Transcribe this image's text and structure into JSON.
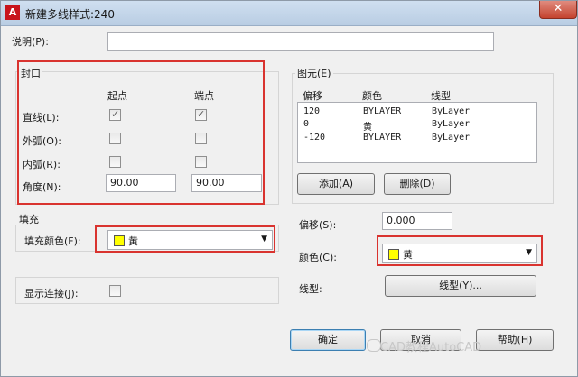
{
  "window": {
    "title": "新建多线样式:240",
    "ghost_text": ""
  },
  "description": {
    "label": "说明(P):",
    "value": ""
  },
  "caps": {
    "group_label": "封口",
    "col_start": "起点",
    "col_end": "端点",
    "line_label": "直线(L):",
    "outer_arc_label": "外弧(O):",
    "inner_arc_label": "内弧(R):",
    "angle_label": "角度(N):",
    "line_start_checked": true,
    "line_end_checked": true,
    "outer_start_checked": false,
    "outer_end_checked": false,
    "inner_start_checked": false,
    "inner_end_checked": false,
    "angle_start": "90.00",
    "angle_end": "90.00"
  },
  "fill": {
    "group_label": "填充",
    "color_label": "填充颜色(F):",
    "color_value": "黄",
    "color_hex": "#ffff00"
  },
  "joints": {
    "label": "显示连接(J):",
    "checked": false
  },
  "elements": {
    "group_label": "图元(E)",
    "headers": {
      "offset": "偏移",
      "color": "颜色",
      "linetype": "线型"
    },
    "rows": [
      {
        "offset": "120",
        "color": "BYLAYER",
        "linetype": "ByLayer"
      },
      {
        "offset": "0",
        "color": "黄",
        "linetype": "ByLayer"
      },
      {
        "offset": "-120",
        "color": "BYLAYER",
        "linetype": "ByLayer"
      }
    ],
    "add_label": "添加(A)",
    "delete_label": "删除(D)",
    "offset_label": "偏移(S):",
    "offset_value": "0.000",
    "color_label": "颜色(C):",
    "color_value": "黄",
    "linetype_label": "线型:",
    "linetype_button": "线型(Y)..."
  },
  "buttons": {
    "ok": "确定",
    "cancel": "取消",
    "help": "帮助(H)"
  },
  "watermark": "CAD教程AutoCAD",
  "colors": {
    "highlight_red": "#d9332f",
    "yellow": "#ffff00"
  }
}
